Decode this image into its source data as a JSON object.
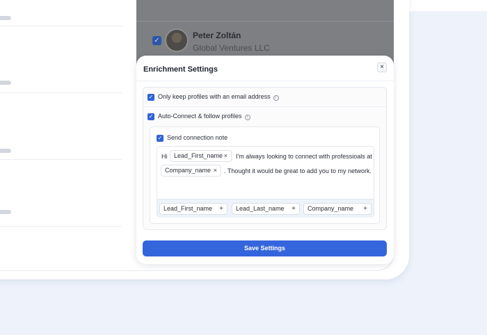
{
  "contact": {
    "name": "Peter Zoltán",
    "company": "Global Ventures LLC",
    "selected": true
  },
  "modal": {
    "title": "Enrichment Settings",
    "close_icon": "close-icon",
    "options": {
      "email_only": {
        "label": "Only keep profiles with an email address",
        "checked": true
      },
      "auto_connect": {
        "label": "Auto-Connect & follow profiles",
        "checked": true
      },
      "send_note": {
        "label": "Send connection note",
        "checked": true
      }
    },
    "note": {
      "greeting": "Hi",
      "chip_first": "Lead_First_name",
      "text_1": "I'm always looking to connect with professioals at",
      "chip_company": "Company_name",
      "text_2": ".  Thought it would be great to add you to my network."
    },
    "variables": [
      "Lead_First_name",
      "Lead_Last_name",
      "Company_name"
    ],
    "save_label": "Save Settings"
  },
  "colors": {
    "accent": "#3565dc",
    "backdrop": "#edf2fb",
    "overlay": "#7d7f83"
  }
}
